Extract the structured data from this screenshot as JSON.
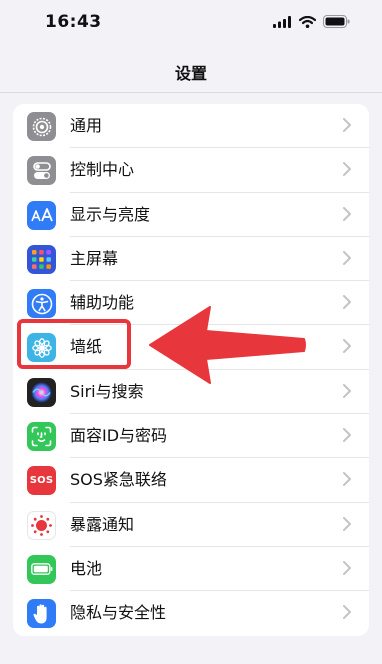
{
  "status_bar": {
    "time": "16:43",
    "icons": [
      "signal-icon",
      "wifi-icon",
      "battery-icon"
    ]
  },
  "nav": {
    "title": "设置"
  },
  "settings": [
    {
      "label": "通用",
      "icon": "gear-icon",
      "color": "#8e8e93"
    },
    {
      "label": "控制中心",
      "icon": "toggles-icon",
      "color": "#8e8e93"
    },
    {
      "label": "显示与亮度",
      "icon": "text-size-icon",
      "color": "#2f7cf6"
    },
    {
      "label": "主屏幕",
      "icon": "app-grid-icon",
      "color": "#3355d8"
    },
    {
      "label": "辅助功能",
      "icon": "accessibility-icon",
      "color": "#2f7cf6"
    },
    {
      "label": "墙纸",
      "icon": "flower-icon",
      "color": "#3db4e6"
    },
    {
      "label": "Siri与搜索",
      "icon": "siri-icon",
      "color": "#222222"
    },
    {
      "label": "面容ID与密码",
      "icon": "face-id-icon",
      "color": "#33c759"
    },
    {
      "label": "SOS紧急联络",
      "icon": "sos-icon",
      "color": "#e8363d",
      "badge": "SOS"
    },
    {
      "label": "暴露通知",
      "icon": "exposure-icon",
      "color": "#ffffff"
    },
    {
      "label": "电池",
      "icon": "battery-app-icon",
      "color": "#33c759"
    },
    {
      "label": "隐私与安全性",
      "icon": "hand-icon",
      "color": "#2f7cf6"
    }
  ],
  "annotation": {
    "highlight_color": "#e8363d"
  }
}
